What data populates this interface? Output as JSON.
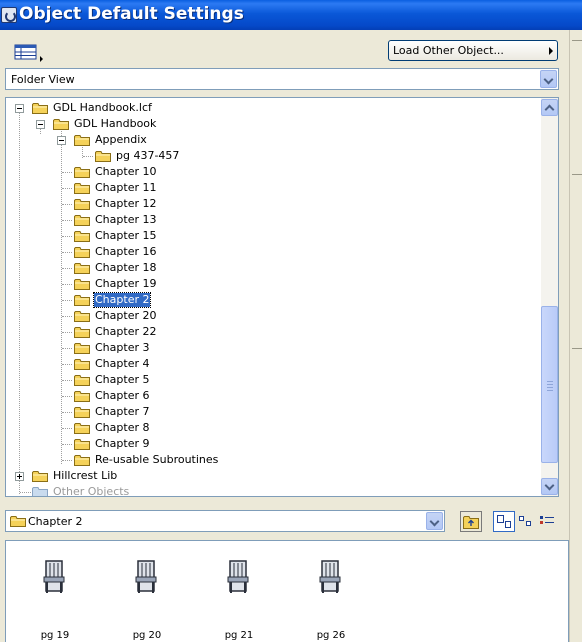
{
  "window": {
    "title": "Object Default Settings"
  },
  "toolbar": {
    "view_menu_icon": "table-view-icon",
    "load_other_label": "Load Other Object..."
  },
  "view_select": {
    "value": "Folder View"
  },
  "tree": {
    "root": "GDL Handbook.lcf",
    "handbook": "GDL Handbook",
    "appendix": "Appendix",
    "appendix_child": "pg 437-457",
    "chapters": [
      "Chapter 10",
      "Chapter 11",
      "Chapter 12",
      "Chapter 13",
      "Chapter 15",
      "Chapter 16",
      "Chapter 18",
      "Chapter 19",
      "Chapter 2",
      "Chapter 20",
      "Chapter 22",
      "Chapter 3",
      "Chapter 4",
      "Chapter 5",
      "Chapter 6",
      "Chapter 7",
      "Chapter 8",
      "Chapter 9",
      "Re-usable Subroutines"
    ],
    "selected": "Chapter 2",
    "hillcrest": "Hillcrest Lib",
    "other": "Other Objects"
  },
  "path_select": {
    "value": "Chapter 2"
  },
  "objects": [
    {
      "label": "pg 19",
      "icon": "chair-object-icon"
    },
    {
      "label": "pg 20",
      "icon": "chair-object-icon"
    },
    {
      "label": "pg 21",
      "icon": "chair-object-icon"
    },
    {
      "label": "pg 26",
      "icon": "chair-object-icon"
    }
  ],
  "colors": {
    "title_bar": "#0a58d8",
    "selection": "#316ac5",
    "folder": "#f5d25a"
  }
}
